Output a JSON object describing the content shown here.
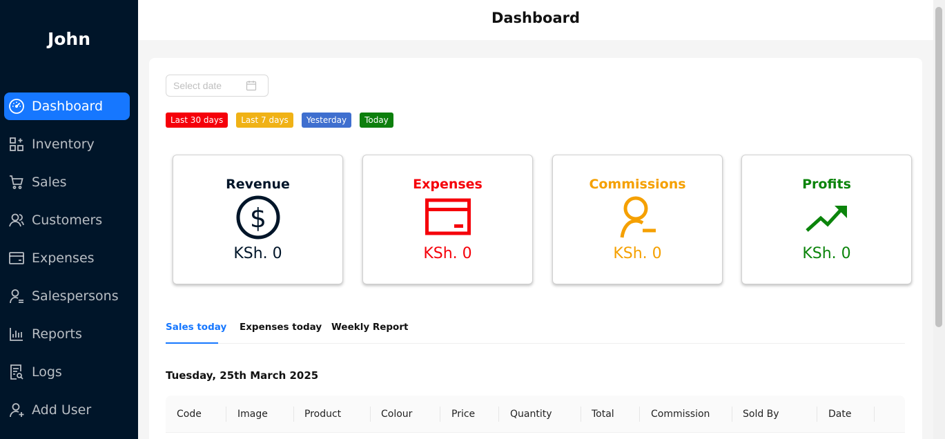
{
  "sidebar": {
    "user_name": "John",
    "items": [
      {
        "label": "Dashboard"
      },
      {
        "label": "Inventory"
      },
      {
        "label": "Sales"
      },
      {
        "label": "Customers"
      },
      {
        "label": "Expenses"
      },
      {
        "label": "Salespersons"
      },
      {
        "label": "Reports"
      },
      {
        "label": "Logs"
      },
      {
        "label": "Add User"
      }
    ]
  },
  "header": {
    "title": "Dashboard"
  },
  "filters": {
    "date_placeholder": "Select date",
    "quick": [
      {
        "label": "Last 30 days",
        "color": "#f5000a"
      },
      {
        "label": "Last 7 days",
        "color": "#f0b216"
      },
      {
        "label": "Yesterday",
        "color": "#3f6fcf"
      },
      {
        "label": "Today",
        "color": "#0d7f0d"
      }
    ]
  },
  "stats": [
    {
      "title": "Revenue",
      "value": "KSh. 0",
      "icon": "dollar-circle-icon",
      "color": "#001529"
    },
    {
      "title": "Expenses",
      "value": "KSh. 0",
      "icon": "credit-card-icon",
      "color": "#f5000a"
    },
    {
      "title": "Commissions",
      "value": "KSh. 0",
      "icon": "user-minus-icon",
      "color": "#f5a000"
    },
    {
      "title": "Profits",
      "value": "KSh. 0",
      "icon": "trend-up-icon",
      "color": "#0b840b"
    }
  ],
  "tabs": [
    {
      "label": "Sales today"
    },
    {
      "label": "Expenses today"
    },
    {
      "label": "Weekly Report"
    }
  ],
  "report_date": "Tuesday, 25th March 2025",
  "table": {
    "columns": [
      "Code",
      "Image",
      "Product",
      "Colour",
      "Price",
      "Quantity",
      "Total",
      "Commission",
      "Sold By",
      "Date"
    ]
  }
}
